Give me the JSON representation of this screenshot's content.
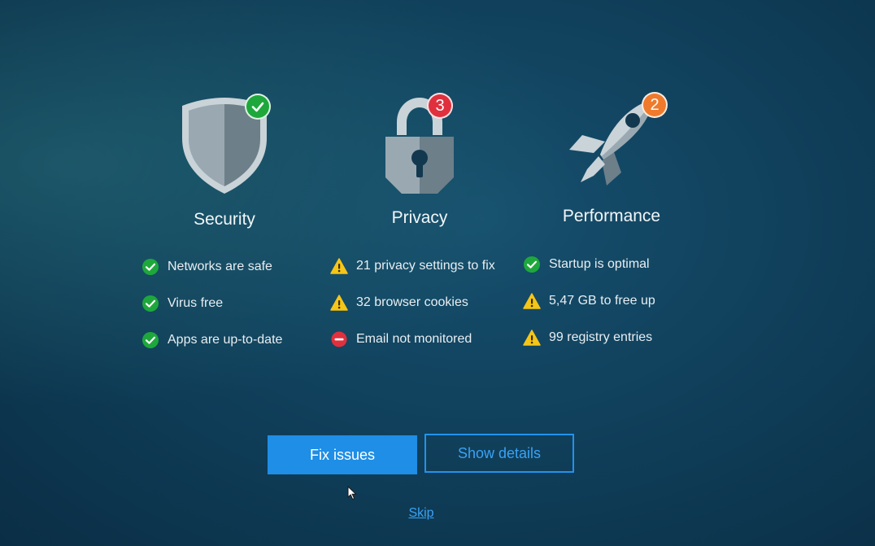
{
  "colors": {
    "ok": "#1ea83c",
    "warn": "#f5c518",
    "error": "#e0303e",
    "accent": "#1e8ee6",
    "badge_privacy": "#e0303e",
    "badge_performance": "#ef7a2c"
  },
  "sections": {
    "security": {
      "title": "Security",
      "icon": "shield-icon",
      "badge_icon": "check-icon",
      "items": [
        {
          "status": "ok",
          "label": "Networks are safe"
        },
        {
          "status": "ok",
          "label": "Virus free"
        },
        {
          "status": "ok",
          "label": "Apps are up-to-date"
        }
      ]
    },
    "privacy": {
      "title": "Privacy",
      "icon": "padlock-icon",
      "badge_count": "3",
      "items": [
        {
          "status": "warn",
          "label": "21 privacy settings to fix"
        },
        {
          "status": "warn",
          "label": "32 browser cookies"
        },
        {
          "status": "error",
          "label": "Email not monitored"
        }
      ]
    },
    "performance": {
      "title": "Performance",
      "icon": "rocket-icon",
      "badge_count": "2",
      "items": [
        {
          "status": "ok",
          "label": "Startup is optimal"
        },
        {
          "status": "warn",
          "label": "5,47 GB to free up"
        },
        {
          "status": "warn",
          "label": "99 registry entries"
        }
      ]
    }
  },
  "actions": {
    "fix_label": "Fix issues",
    "details_label": "Show details",
    "skip_label": "Skip"
  }
}
